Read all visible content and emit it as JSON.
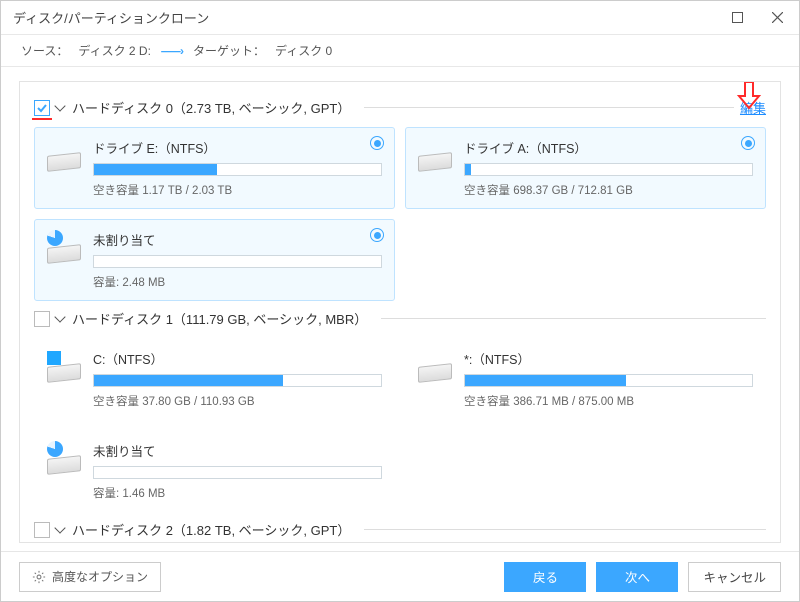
{
  "window": {
    "title": "ディスク/パーティションクローン"
  },
  "sourcebar": {
    "source_label": "ソース：",
    "source_value": "ディスク 2 D:",
    "target_label": "ターゲット：",
    "target_value": "ディスク 0"
  },
  "edit_link": "編集",
  "disks": [
    {
      "checked": true,
      "name": "ハードディスク 0（2.73 TB, ベーシック, GPT）",
      "show_edit": true,
      "card_style": "highlight",
      "partitions": [
        {
          "title": "ドライブ E:（NTFS）",
          "cap": "空き容量 1.17 TB / 2.03 TB",
          "fill_pct": 43,
          "icon": "plain"
        },
        {
          "title": "ドライブ A:（NTFS）",
          "cap": "空き容量 698.37 GB / 712.81 GB",
          "fill_pct": 2,
          "icon": "plain"
        },
        {
          "title": "未割り当て",
          "cap": "容量: 2.48 MB",
          "fill_pct": 0,
          "icon": "pie"
        }
      ]
    },
    {
      "checked": false,
      "name": "ハードディスク 1（111.79 GB, ベーシック, MBR）",
      "show_edit": false,
      "card_style": "plain",
      "partitions": [
        {
          "title": "C:（NTFS）",
          "cap": "空き容量 37.80 GB / 110.93 GB",
          "fill_pct": 66,
          "icon": "win"
        },
        {
          "title": "*:（NTFS）",
          "cap": "空き容量 386.71 MB / 875.00 MB",
          "fill_pct": 56,
          "icon": "plain"
        },
        {
          "title": "未割り当て",
          "cap": "容量: 1.46 MB",
          "fill_pct": 0,
          "icon": "pie"
        }
      ]
    },
    {
      "checked": false,
      "name": "ハードディスク 2（1.82 TB, ベーシック, GPT）",
      "show_edit": false,
      "card_style": "plain",
      "partitions": []
    }
  ],
  "footer": {
    "advanced": "高度なオプション",
    "back": "戻る",
    "next": "次へ",
    "cancel": "キャンセル"
  }
}
